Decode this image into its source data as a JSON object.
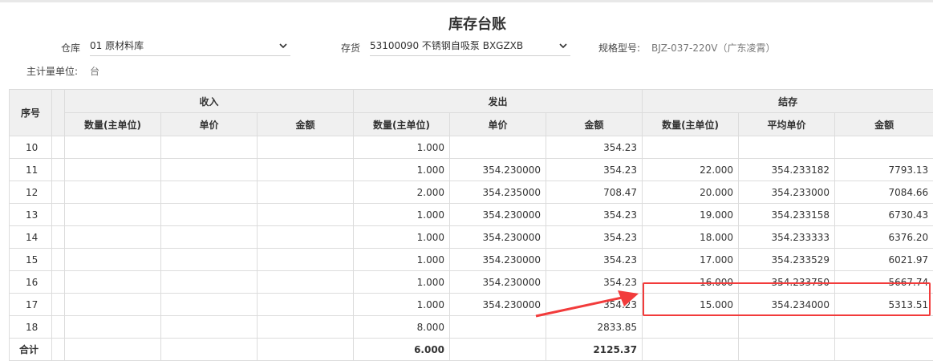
{
  "title": "库存台账",
  "filters": {
    "warehouse_label": "仓库",
    "warehouse_value": "01 原材料库",
    "inventory_label": "存货",
    "inventory_value": "53100090 不锈钢自吸泵 BXGZXB",
    "spec_label": "规格型号:",
    "spec_value": "BJZ-037-220V（广东凌霄）",
    "unit_label": "主计量单位:",
    "unit_value": "台"
  },
  "table": {
    "col_index": "序号",
    "group_in": "收入",
    "group_out": "发出",
    "group_balance": "结存",
    "in_qty": "数量(主单位)",
    "in_price": "单价",
    "in_amount": "金额",
    "out_qty": "数量(主单位)",
    "out_price": "单价",
    "out_amount": "金额",
    "bal_qty": "数量(主单位)",
    "bal_price": "平均单价",
    "bal_amount": "金额",
    "rows": [
      {
        "idx": "10",
        "out_qty": "1.000",
        "out_price": "",
        "out_amount": "354.23",
        "bal_qty": "",
        "bal_price": "",
        "bal_amount": ""
      },
      {
        "idx": "11",
        "out_qty": "1.000",
        "out_price": "354.230000",
        "out_amount": "354.23",
        "bal_qty": "22.000",
        "bal_price": "354.233182",
        "bal_amount": "7793.13"
      },
      {
        "idx": "12",
        "out_qty": "2.000",
        "out_price": "354.235000",
        "out_amount": "708.47",
        "bal_qty": "20.000",
        "bal_price": "354.233000",
        "bal_amount": "7084.66"
      },
      {
        "idx": "13",
        "out_qty": "1.000",
        "out_price": "354.230000",
        "out_amount": "354.23",
        "bal_qty": "19.000",
        "bal_price": "354.233158",
        "bal_amount": "6730.43"
      },
      {
        "idx": "14",
        "out_qty": "1.000",
        "out_price": "354.230000",
        "out_amount": "354.23",
        "bal_qty": "18.000",
        "bal_price": "354.233333",
        "bal_amount": "6376.20"
      },
      {
        "idx": "15",
        "out_qty": "1.000",
        "out_price": "354.230000",
        "out_amount": "354.23",
        "bal_qty": "17.000",
        "bal_price": "354.233529",
        "bal_amount": "6021.97"
      },
      {
        "idx": "16",
        "out_qty": "1.000",
        "out_price": "354.230000",
        "out_amount": "354.23",
        "bal_qty": "16.000",
        "bal_price": "354.233750",
        "bal_amount": "5667.74"
      },
      {
        "idx": "17",
        "out_qty": "1.000",
        "out_price": "354.230000",
        "out_amount": "354.23",
        "bal_qty": "15.000",
        "bal_price": "354.234000",
        "bal_amount": "5313.51"
      },
      {
        "idx": "18",
        "out_qty": "8.000",
        "out_price": "",
        "out_amount": "2833.85",
        "bal_qty": "",
        "bal_price": "",
        "bal_amount": ""
      }
    ],
    "total": {
      "label": "合计",
      "out_qty": "6.000",
      "out_amount": "2125.37"
    }
  },
  "colors": {
    "highlight": "#f23b3b",
    "header_bg": "#f0f0f0",
    "border": "#dcdcdc"
  },
  "icons": {
    "dropdown": "chevron-down-icon"
  }
}
